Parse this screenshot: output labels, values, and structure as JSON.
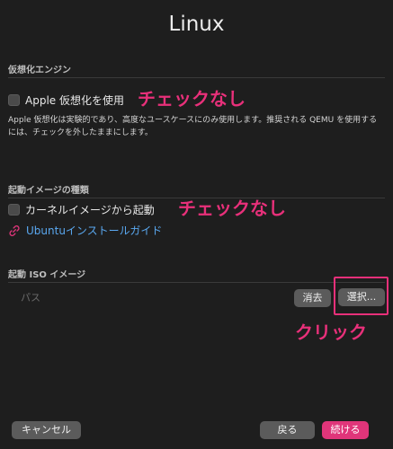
{
  "window": {
    "title": "Linux"
  },
  "virtualization": {
    "section_label": "仮想化エンジン",
    "checkbox_label": "Apple 仮想化を使用",
    "checked": false,
    "description": "Apple 仮想化は実験的であり、高度なユースケースにのみ使用します。推奨される QEMU を使用するには、チェックを外したままにします。"
  },
  "boot_image_type": {
    "section_label": "起動イメージの種類",
    "checkbox_label": "カーネルイメージから起動",
    "checked": false,
    "guide_link": "Ubuntuインストールガイド"
  },
  "boot_iso": {
    "section_label": "起動 ISO イメージ",
    "path_placeholder": "パス",
    "clear_label": "消去",
    "select_label": "選択..."
  },
  "annotations": {
    "no_check_1": "チェックなし",
    "no_check_2": "チェックなし",
    "click": "クリック",
    "color": "#e8307a"
  },
  "footer": {
    "cancel_label": "キャンセル",
    "back_label": "戻る",
    "continue_label": "続ける"
  },
  "colors": {
    "accent": "#e0357a",
    "link": "#5aa8f0",
    "background": "#1e1e1e"
  }
}
